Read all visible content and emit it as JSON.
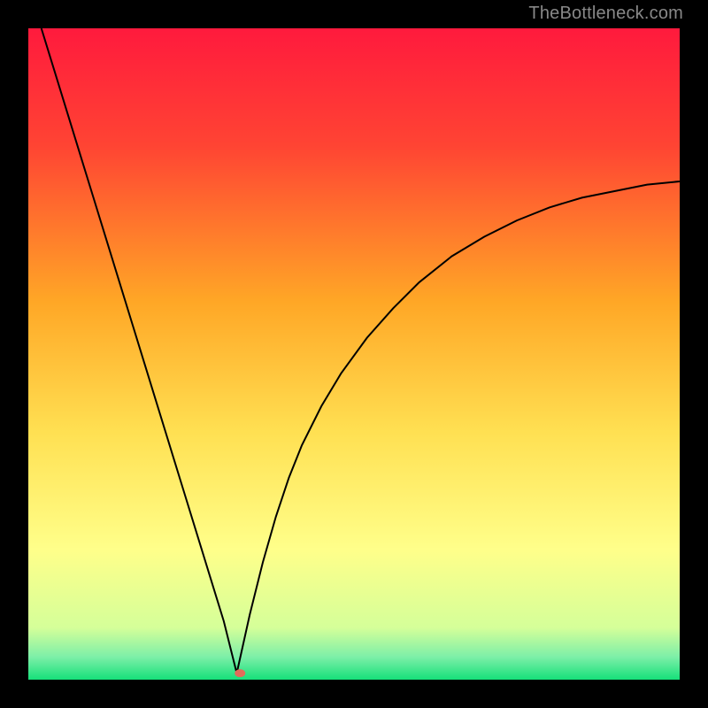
{
  "attribution": "TheBottleneck.com",
  "chart_data": {
    "type": "line",
    "title": "",
    "xlabel": "",
    "ylabel": "",
    "xlim": [
      0,
      100
    ],
    "ylim": [
      0,
      100
    ],
    "grid": false,
    "background": {
      "type": "vertical-gradient",
      "stops": [
        {
          "pos": 0.0,
          "color": "#ff1a3d"
        },
        {
          "pos": 0.18,
          "color": "#ff4433"
        },
        {
          "pos": 0.42,
          "color": "#ffa726"
        },
        {
          "pos": 0.62,
          "color": "#ffe052"
        },
        {
          "pos": 0.8,
          "color": "#ffff8a"
        },
        {
          "pos": 0.92,
          "color": "#d5ff99"
        },
        {
          "pos": 0.965,
          "color": "#7defa8"
        },
        {
          "pos": 1.0,
          "color": "#16e07a"
        }
      ]
    },
    "series": [
      {
        "name": "left-branch",
        "color": "#000000",
        "x": [
          2,
          4,
          6,
          8,
          10,
          12,
          14,
          16,
          18,
          20,
          22,
          24,
          26,
          28,
          30,
          31,
          32
        ],
        "y": [
          100,
          93.5,
          87,
          80.5,
          74,
          67.5,
          61,
          54.5,
          48,
          41.5,
          35,
          28.5,
          22,
          15.5,
          9,
          5,
          1
        ]
      },
      {
        "name": "right-branch",
        "color": "#000000",
        "x": [
          32,
          34,
          36,
          38,
          40,
          42,
          45,
          48,
          52,
          56,
          60,
          65,
          70,
          75,
          80,
          85,
          90,
          95,
          100
        ],
        "y": [
          1,
          10,
          18,
          25,
          31,
          36,
          42,
          47,
          52.5,
          57,
          61,
          65,
          68,
          70.5,
          72.5,
          74,
          75,
          76,
          76.5
        ]
      }
    ],
    "markers": [
      {
        "name": "minimum-marker",
        "x": 32.5,
        "y": 1,
        "color": "#e36b5a",
        "rx": 6,
        "ry": 4.5
      }
    ]
  }
}
